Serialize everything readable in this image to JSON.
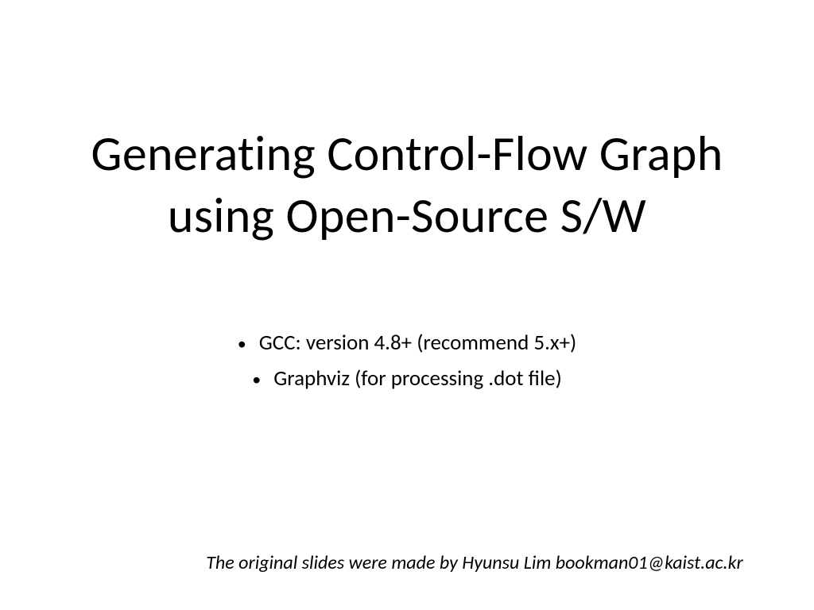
{
  "slide": {
    "title_line1": "Generating Control-Flow Graph",
    "title_line2": "using Open-Source S/W",
    "bullets": [
      "GCC: version 4.8+ (recommend 5.x+)",
      "Graphviz (for processing .dot file)"
    ],
    "footer": "The original slides were made by Hyunsu Lim bookman01@kaist.ac.kr"
  }
}
